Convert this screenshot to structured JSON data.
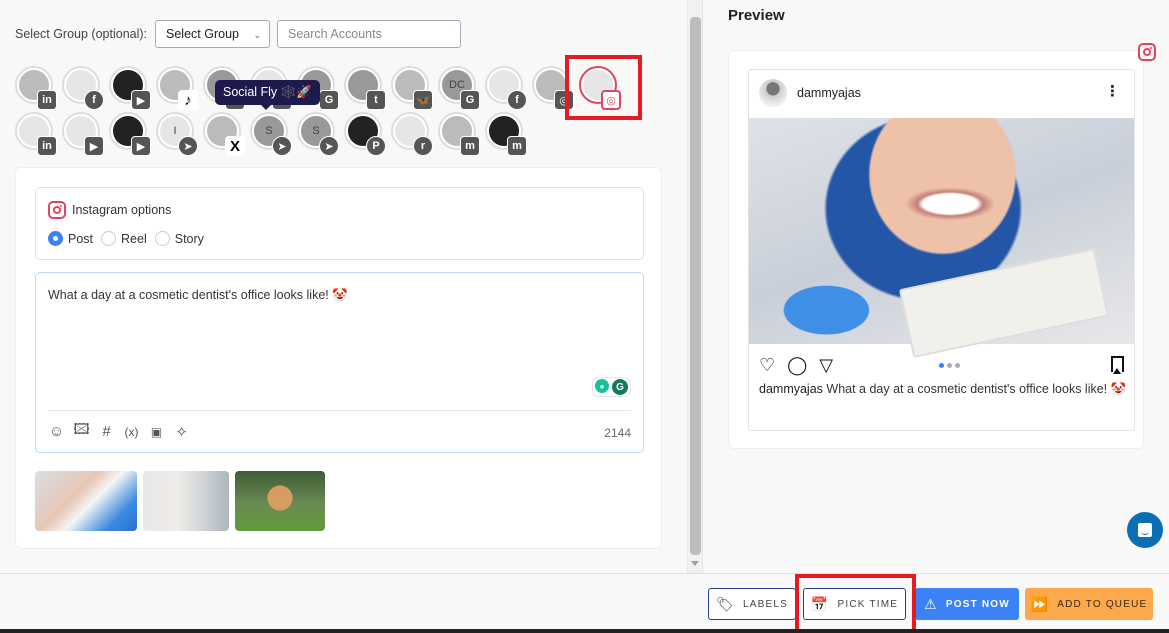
{
  "group_select": {
    "label": "Select Group (optional):",
    "value": "Select Group",
    "search_placeholder": "Search Accounts"
  },
  "accounts": [
    {
      "platform": "linkedin",
      "badge": "in",
      "initials": ""
    },
    {
      "platform": "facebook",
      "badge": "f",
      "initials": ""
    },
    {
      "platform": "youtube",
      "badge": "▶",
      "initials": ""
    },
    {
      "platform": "tiktok",
      "badge": "♪",
      "initials": ""
    },
    {
      "platform": "google-business",
      "badge": "G",
      "initials": ""
    },
    {
      "platform": "google-business",
      "badge": "G",
      "initials": ""
    },
    {
      "platform": "google-business",
      "badge": "G",
      "initials": ""
    },
    {
      "platform": "tumblr",
      "badge": "t",
      "initials": ""
    },
    {
      "platform": "bluesky",
      "badge": "🦋",
      "initials": ""
    },
    {
      "platform": "google-business",
      "badge": "G",
      "initials": "DC"
    },
    {
      "platform": "facebook",
      "badge": "f",
      "initials": ""
    },
    {
      "platform": "instagram",
      "badge": "◎",
      "initials": ""
    },
    {
      "platform": "instagram",
      "badge": "◎",
      "initials": "",
      "selected": true
    },
    {
      "platform": "linkedin",
      "badge": "in",
      "initials": ""
    },
    {
      "platform": "youtube",
      "badge": "▶",
      "initials": ""
    },
    {
      "platform": "youtube",
      "badge": "▶",
      "initials": ""
    },
    {
      "platform": "telegram",
      "badge": "➤",
      "initials": "I"
    },
    {
      "platform": "x",
      "badge": "X",
      "initials": ""
    },
    {
      "platform": "telegram",
      "badge": "➤",
      "initials": "S"
    },
    {
      "platform": "telegram",
      "badge": "➤",
      "initials": "S"
    },
    {
      "platform": "pinterest",
      "badge": "P",
      "initials": ""
    },
    {
      "platform": "reddit",
      "badge": "r",
      "initials": ""
    },
    {
      "platform": "mastodon",
      "badge": "m",
      "initials": ""
    },
    {
      "platform": "mastodon",
      "badge": "m",
      "initials": ""
    }
  ],
  "tooltip": "Social Fly 🕸️🚀",
  "instagram_options": {
    "title": "Instagram options",
    "types": [
      {
        "label": "Post",
        "checked": true
      },
      {
        "label": "Reel",
        "checked": false
      },
      {
        "label": "Story",
        "checked": false
      }
    ]
  },
  "editor": {
    "text": "What a day at a cosmetic dentist's office looks like! 🤡",
    "char_count": "2144",
    "tools": [
      "emoji-icon",
      "image-icon",
      "hashtag-icon",
      "variable-icon",
      "layout-icon",
      "ai-sparkle-icon"
    ]
  },
  "media_thumbnails": [
    "dentist-smile",
    "woman-washing-face",
    "poodle-on-grass"
  ],
  "preview": {
    "title": "Preview",
    "username": "dammyajas",
    "caption_user": "dammyajas",
    "caption_text": " What a day at a cosmetic dentist's office looks like! 🤡"
  },
  "actions": {
    "labels": "LABELS",
    "pick_time": "PICK TIME",
    "post_now": "POST NOW",
    "add_to_queue": "ADD TO QUEUE"
  },
  "colors": {
    "instagram": "#e0455f",
    "primary": "#3b82f6",
    "queue": "#fba94c",
    "highlight": "#e31b23"
  }
}
